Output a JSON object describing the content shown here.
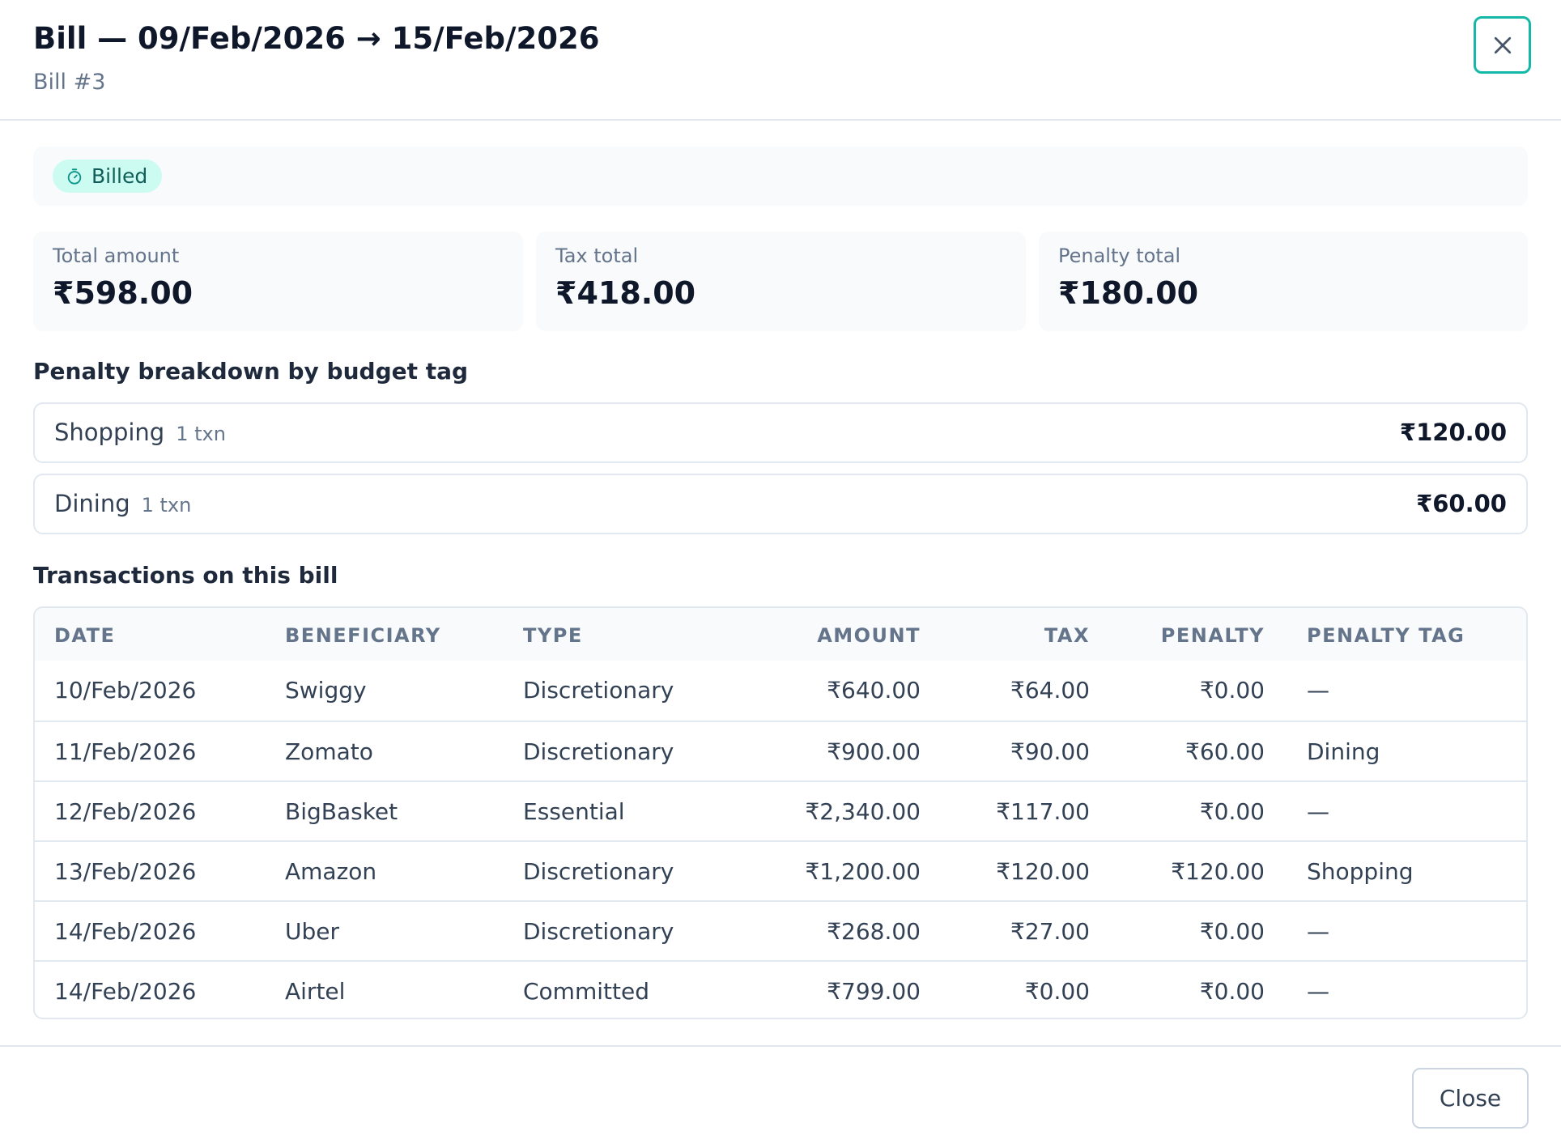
{
  "modal": {
    "title": "Bill — 09/Feb/2026 → 15/Feb/2026",
    "subtitle": "Bill #3",
    "close_icon": "close-icon"
  },
  "status": {
    "label": "Billed",
    "icon": "stopwatch-icon",
    "color": "#14b8a6"
  },
  "stats": [
    {
      "label": "Total amount",
      "value": "₹598.00"
    },
    {
      "label": "Tax total",
      "value": "₹418.00"
    },
    {
      "label": "Penalty total",
      "value": "₹180.00"
    }
  ],
  "penalty_breakdown": {
    "title": "Penalty breakdown by budget tag",
    "items": [
      {
        "tag": "Shopping",
        "count": "1 txn",
        "amount": "₹120.00"
      },
      {
        "tag": "Dining",
        "count": "1 txn",
        "amount": "₹60.00"
      }
    ]
  },
  "transactions": {
    "title": "Transactions on this bill",
    "columns": [
      "DATE",
      "BENEFICIARY",
      "TYPE",
      "AMOUNT",
      "TAX",
      "PENALTY",
      "PENALTY TAG"
    ],
    "rows": [
      {
        "date": "10/Feb/2026",
        "beneficiary": "Swiggy",
        "type": "Discretionary",
        "amount": "₹640.00",
        "tax": "₹64.00",
        "penalty": "₹0.00",
        "penalty_tag": "—"
      },
      {
        "date": "11/Feb/2026",
        "beneficiary": "Zomato",
        "type": "Discretionary",
        "amount": "₹900.00",
        "tax": "₹90.00",
        "penalty": "₹60.00",
        "penalty_tag": "Dining"
      },
      {
        "date": "12/Feb/2026",
        "beneficiary": "BigBasket",
        "type": "Essential",
        "amount": "₹2,340.00",
        "tax": "₹117.00",
        "penalty": "₹0.00",
        "penalty_tag": "—"
      },
      {
        "date": "13/Feb/2026",
        "beneficiary": "Amazon",
        "type": "Discretionary",
        "amount": "₹1,200.00",
        "tax": "₹120.00",
        "penalty": "₹120.00",
        "penalty_tag": "Shopping"
      },
      {
        "date": "14/Feb/2026",
        "beneficiary": "Uber",
        "type": "Discretionary",
        "amount": "₹268.00",
        "tax": "₹27.00",
        "penalty": "₹0.00",
        "penalty_tag": "—"
      },
      {
        "date": "14/Feb/2026",
        "beneficiary": "Airtel",
        "type": "Committed",
        "amount": "₹799.00",
        "tax": "₹0.00",
        "penalty": "₹0.00",
        "penalty_tag": "—"
      }
    ]
  },
  "footer": {
    "close_label": "Close"
  }
}
